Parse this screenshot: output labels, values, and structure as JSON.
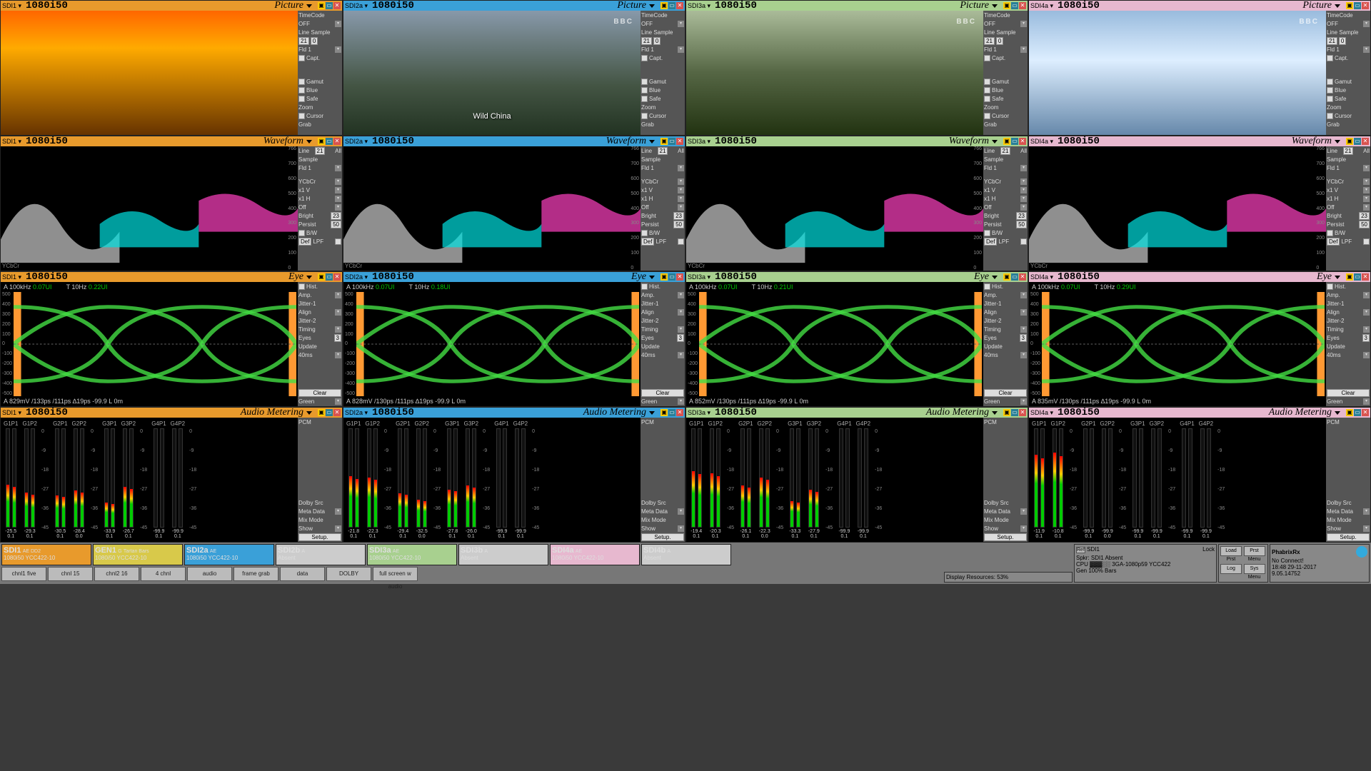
{
  "channels": [
    {
      "src": "SDI1",
      "color": "hdr-orange",
      "fmt": "1080i50"
    },
    {
      "src": "SDI2a",
      "color": "hdr-blue",
      "fmt": "1080i50"
    },
    {
      "src": "SDI3a",
      "color": "hdr-green",
      "fmt": "1080i50"
    },
    {
      "src": "SDI4a",
      "color": "hdr-pink",
      "fmt": "1080i50"
    }
  ],
  "modes": {
    "picture": "Picture",
    "waveform": "Waveform",
    "eye": "Eye",
    "audio": "Audio Metering"
  },
  "picture_side": {
    "timecode": "TimeCode",
    "off": "OFF",
    "line_sample": "Line Sample",
    "line_val": "21",
    "sample_val": "0",
    "fld": "Fld 1",
    "capt": "Capt.",
    "gamut": "Gamut",
    "blue": "Blue",
    "safe": "Safe",
    "zoom": "Zoom",
    "cursor": "Cursor",
    "grab": "Grab"
  },
  "waveform_side": {
    "line": "Line",
    "all": "All",
    "sample": "Sample",
    "line_val": "21",
    "fld": "Fld 1",
    "ycbcr": "YCbCr",
    "x1v": "x1 V",
    "x1h": "x1 H",
    "off": "Off",
    "bright": "Bright",
    "bright_val": "23",
    "persist": "Persist",
    "persist_val": "50",
    "bw": "B/W",
    "def": "Def",
    "lpf": "LPF"
  },
  "waveform_label": "YCbCr",
  "waveform_scale": [
    "766",
    "700",
    "600",
    "500",
    "400",
    "300",
    "200",
    "100",
    "0"
  ],
  "eye_side": {
    "hist": "Hist.",
    "amp": "Amp.",
    "jitter1": "Jitter-1",
    "align": "Align",
    "jitter2": "Jitter-2",
    "timing": "Timing",
    "eyes": "Eyes",
    "eyes_val": "3",
    "update": "Update",
    "update_val": "40ms",
    "clear": "Clear",
    "green": "Green"
  },
  "eye_meas": [
    {
      "a": "A 100kHz",
      "av": "0.07UI",
      "t": "T 10Hz",
      "tv": "0.22UI",
      "btm": "A 829mV   /133ps   /111ps   ∆19ps   -99.9   L 0m"
    },
    {
      "a": "A 100kHz",
      "av": "0.07UI",
      "t": "T 10Hz",
      "tv": "0.18UI",
      "btm": "A 828mV   /130ps   /111ps   ∆19ps   -99.9   L 0m"
    },
    {
      "a": "A 100kHz",
      "av": "0.07UI",
      "t": "T 10Hz",
      "tv": "0.21UI",
      "btm": "A 852mV   /130ps   /111ps   ∆19ps   -99.9   L 0m"
    },
    {
      "a": "A 100kHz",
      "av": "0.07UI",
      "t": "T 10Hz",
      "tv": "0.29UI",
      "btm": "A 835mV   /130ps   /111ps   ∆19ps   -99.9   L 0m"
    }
  ],
  "eye_scale": [
    "500",
    "400",
    "300",
    "200",
    "100",
    "0",
    "-100",
    "-200",
    "-300",
    "-400",
    "-500"
  ],
  "audio_side": {
    "pcm": "PCM",
    "dolby_src": "Dolby Src",
    "meta_data": "Meta Data",
    "mix_mode": "Mix Mode",
    "show": "Show",
    "setup": "Setup."
  },
  "audio_groups": [
    "G1P1",
    "G1P2",
    "G2P1",
    "G2P2",
    "G3P1",
    "G3P2",
    "G4P1",
    "G4P2"
  ],
  "audio_scale": [
    "0",
    "-9",
    "-18",
    "-27",
    "-36",
    "-45"
  ],
  "audio_vals": [
    [
      "-25.5",
      "-29.3",
      "-30.5",
      "-28.4",
      "-33.9",
      "-26.7",
      "-99.9",
      "-99.9"
    ],
    [
      "-21.8",
      "-22.3",
      "-29.4",
      "-32.5",
      "-27.8",
      "-26.0",
      "-99.9",
      "-99.9"
    ],
    [
      "-19.4",
      "-20.3",
      "-26.1",
      "-22.3",
      "-33.3",
      "-27.9",
      "-99.9",
      "-99.9"
    ],
    [
      "-11.9",
      "-10.8",
      "-99.9",
      "-99.9",
      "-99.9",
      "-99.9",
      "-99.9",
      "-99.9"
    ]
  ],
  "audio_sub": [
    "0.1",
    "0.1",
    "0.1",
    "0.0",
    "0.1",
    "0.1",
    "0.1",
    "0.1"
  ],
  "sources": [
    {
      "name": "SDI1",
      "flags": "AE   DD2",
      "sub": "1080i50 YCC422-10",
      "bg": "#e89a2c"
    },
    {
      "name": "GEN1",
      "flags": "G",
      "sub": "1080i50 YCC422-10",
      "bg": "#d8c94a",
      "extra": "Tartan Bars"
    },
    {
      "name": "SDI2a",
      "flags": "AE",
      "sub": "1080i50 YCC422-10",
      "bg": "#3aa0d8"
    },
    {
      "name": "SDI2b",
      "flags": "A",
      "sub": "Absent",
      "bg": "#ccc"
    },
    {
      "name": "SDI3a",
      "flags": "AE",
      "sub": "1080i50 YCC422-10",
      "bg": "#a8d08f"
    },
    {
      "name": "SDI3b",
      "flags": "A",
      "sub": "Absent",
      "bg": "#ccc"
    },
    {
      "name": "SDI4a",
      "flags": "AE",
      "sub": "1080i50 YCC422-10",
      "bg": "#e7b8cf"
    },
    {
      "name": "SDI4b",
      "flags": "A",
      "sub": "Absent",
      "bg": "#ccc"
    }
  ],
  "quick_buttons": [
    "chnl1 five",
    "chnl 15",
    "chnl2 16",
    "4 chnl",
    "audio",
    "frame grab",
    "data",
    "DOLBY",
    "full screen w audio"
  ],
  "display_resources": "Display Resources: 53%",
  "status": {
    "ref": "Ref",
    "ref_val": "SDI1",
    "lock": "Lock",
    "spkr": "Spkr",
    "spkr_val": "SDI1 Absent",
    "cpu": "CPU",
    "gen": "Gen",
    "gen1": "3GA-1080p59 YCC422",
    "gen2": "100% Bars"
  },
  "menu_buttons": [
    "Load Prst",
    "Prst Menu",
    "Log",
    "Sys Menu"
  ],
  "brand": "PhabrixRx",
  "noconnect": "No Connect!",
  "datetime": "18:48  29-11-2017",
  "version": "9.05.14752",
  "pic_caption": "Wild China",
  "pic_bbc": "BBC"
}
